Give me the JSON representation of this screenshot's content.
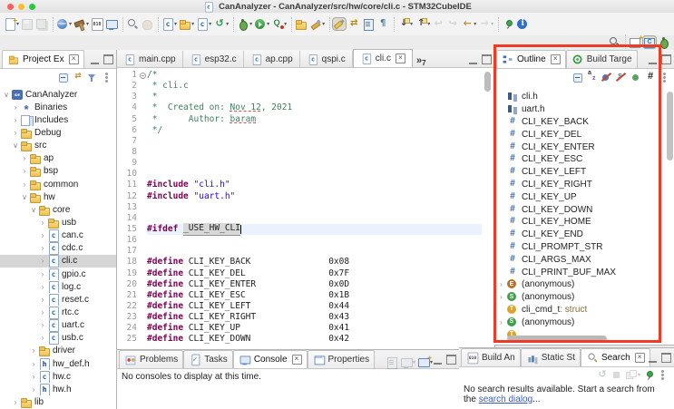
{
  "ui": {
    "dd_glyph": "▾",
    "close_glyph": "×",
    "overflow_glyph": "»"
  },
  "window": {
    "title": "CanAnalyzer - CanAnalyzer/src/hw/core/cli.c - STM32CubeIDE",
    "traffic_red": "#ff5f57",
    "traffic_yellow": "#febc2e",
    "traffic_green": "#28c840"
  },
  "toolbar": {
    "items": [
      {
        "n": "new-wizard-button",
        "cls": "i-newdoc",
        "ddc": "show"
      },
      {
        "n": "save-button",
        "cls": "i-save",
        "state": "dis"
      },
      {
        "n": "save-all-button",
        "cls": "i-saveall",
        "state": "dis"
      },
      {
        "n": "information-center-button",
        "cls": "i-globe",
        "ddc": "show",
        "sepc": "sep"
      },
      {
        "n": "build-button",
        "cls": "i-hammer",
        "ddc": "show"
      },
      {
        "n": "build-binary-button",
        "cls": "i-bin010"
      },
      {
        "n": "terminal-button",
        "cls": "i-term"
      },
      {
        "n": "search-declaration-button",
        "cls": "i-magslash",
        "sepc": "sep"
      },
      {
        "n": "hand-mode-button",
        "cls": "i-hand",
        "state": "dis"
      },
      {
        "n": "new-c-source-button",
        "cls": "i-cfile",
        "ddc": "show",
        "sepc": "sep"
      },
      {
        "n": "new-folder-button",
        "cls": "i-folder",
        "ddc": "show"
      },
      {
        "n": "new-class-button",
        "cls": "i-cfile",
        "ddc": "show"
      },
      {
        "n": "refresh-index-button",
        "cls": "i-refresh",
        "ddc": "show"
      },
      {
        "n": "debug-button",
        "cls": "i-bug",
        "ddc": "show",
        "sepc": "sep"
      },
      {
        "n": "run-button",
        "cls": "i-run",
        "ddc": "show"
      },
      {
        "n": "profile-button",
        "cls": "i-profile",
        "ddc": "show"
      },
      {
        "n": "open-element-button",
        "cls": "i-folder",
        "sepc": "sep"
      },
      {
        "n": "search-button",
        "cls": "i-flash",
        "ddc": "show"
      },
      {
        "n": "mark-occurrences-button",
        "cls": "i-highlight",
        "state": "pr",
        "sepc": "sep"
      },
      {
        "n": "link-with-editor-button",
        "cls": "i-link"
      },
      {
        "n": "show-selected-element-button",
        "cls": "i-bluedoc"
      },
      {
        "n": "show-whitespace-button",
        "cls": "i-pilcrow"
      },
      {
        "n": "next-annotation-button",
        "cls": "i-down",
        "ddc": "show",
        "sepc": "sep"
      },
      {
        "n": "previous-annotation-button",
        "cls": "i-up",
        "ddc": "show"
      },
      {
        "n": "back-history-button",
        "cls": "i-back",
        "state": "dis"
      },
      {
        "n": "forward-history-button",
        "cls": "i-fwd",
        "state": "dis"
      },
      {
        "n": "last-edit-location-button",
        "cls": "i-lastedit",
        "ddc": "show"
      },
      {
        "n": "go-forward-button",
        "cls": "i-fwd2",
        "ddc": "show",
        "state": "dis"
      },
      {
        "n": "pin-editor-button",
        "cls": "i-pin",
        "sepc": "sep"
      },
      {
        "n": "info-button",
        "cls": "i-info"
      }
    ],
    "right_items": [
      {
        "n": "quick-access-search-button",
        "cls": "i-mag"
      },
      {
        "n": "open-perspective-button",
        "cls": "i-perspnew",
        "sepc": "sep"
      },
      {
        "n": "c-cpp-perspective-button",
        "cls": "i-perspc",
        "state": "pr"
      },
      {
        "n": "debug-perspective-button",
        "cls": "i-perspdebug"
      }
    ]
  },
  "explorer": {
    "tab_label": "Project Ex",
    "tools": [
      {
        "n": "collapse-all-button",
        "cls": "i-collapse"
      },
      {
        "n": "link-editor-button",
        "cls": "i-linked"
      },
      {
        "n": "filter-button",
        "cls": "i-filter"
      },
      {
        "n": "view-menu-button",
        "cls": "i-kebab"
      }
    ],
    "items": [
      {
        "chev": "∨",
        "cls": "i-ide",
        "icn": "project-icon",
        "label": "CanAnalyzer",
        "pad": 2
      },
      {
        "chev": "›",
        "cls": "i-binaries",
        "icn": "binaries-icon",
        "label": "Binaries",
        "pad": 12
      },
      {
        "chev": "›",
        "cls": "i-includes",
        "icn": "includes-icon",
        "label": "Includes",
        "pad": 12
      },
      {
        "chev": "›",
        "cls": "i-folder",
        "icn": "folder-icon",
        "label": "Debug",
        "pad": 12
      },
      {
        "chev": "∨",
        "cls": "i-folder",
        "icn": "folder-icon",
        "label": "src",
        "pad": 12
      },
      {
        "chev": "›",
        "cls": "i-folder",
        "icn": "folder-icon",
        "label": "ap",
        "pad": 22
      },
      {
        "chev": "›",
        "cls": "i-folder",
        "icn": "folder-icon",
        "label": "bsp",
        "pad": 22
      },
      {
        "chev": "›",
        "cls": "i-folder",
        "icn": "folder-icon",
        "label": "common",
        "pad": 22
      },
      {
        "chev": "∨",
        "cls": "i-folder",
        "icn": "folder-icon",
        "label": "hw",
        "pad": 22
      },
      {
        "chev": "∨",
        "cls": "i-folder",
        "icn": "folder-icon",
        "label": "core",
        "pad": 32
      },
      {
        "chev": "›",
        "cls": "i-folder",
        "icn": "folder-icon",
        "label": "usb",
        "pad": 42
      },
      {
        "chev": "›",
        "cls": "i-cfile",
        "icn": "c-file-icon",
        "label": "can.c",
        "pad": 42
      },
      {
        "chev": "›",
        "cls": "i-cfile",
        "icn": "c-file-icon",
        "label": "cdc.c",
        "pad": 42
      },
      {
        "chev": "›",
        "cls": "i-cfile",
        "icn": "c-file-icon",
        "label": "cli.c",
        "pad": 42,
        "sel": "sel"
      },
      {
        "chev": "›",
        "cls": "i-cfile",
        "icn": "c-file-icon",
        "label": "gpio.c",
        "pad": 42
      },
      {
        "chev": "›",
        "cls": "i-cfile",
        "icn": "c-file-icon",
        "label": "log.c",
        "pad": 42
      },
      {
        "chev": "›",
        "cls": "i-cfile",
        "icn": "c-file-icon",
        "label": "reset.c",
        "pad": 42
      },
      {
        "chev": "›",
        "cls": "i-cfile",
        "icn": "c-file-icon",
        "label": "rtc.c",
        "pad": 42
      },
      {
        "chev": "›",
        "cls": "i-cfile",
        "icn": "c-file-icon",
        "label": "uart.c",
        "pad": 42
      },
      {
        "chev": "›",
        "cls": "i-cfile",
        "icn": "c-file-icon",
        "label": "usb.c",
        "pad": 42
      },
      {
        "chev": "›",
        "cls": "i-folder",
        "icn": "folder-icon",
        "label": "driver",
        "pad": 32
      },
      {
        "chev": "›",
        "cls": "i-hfile",
        "icn": "h-file-icon",
        "label": "hw_def.h",
        "pad": 32
      },
      {
        "chev": "›",
        "cls": "i-cfile",
        "icn": "c-file-icon",
        "label": "hw.c",
        "pad": 32
      },
      {
        "chev": "›",
        "cls": "i-hfile",
        "icn": "h-file-icon",
        "label": "hw.h",
        "pad": 32
      },
      {
        "chev": "›",
        "cls": "i-folder",
        "icn": "folder-icon",
        "label": "lib",
        "pad": 12
      }
    ]
  },
  "editor": {
    "tabs": [
      {
        "label": "main.cpp",
        "cls": "i-cfile"
      },
      {
        "label": "esp32.c",
        "cls": "i-cfile"
      },
      {
        "label": "ap.cpp",
        "cls": "i-cfile"
      },
      {
        "label": "qspi.c",
        "cls": "i-cfile"
      },
      {
        "label": "cli.c",
        "cls": "i-cfile",
        "act": "active",
        "close": "show"
      }
    ],
    "overflow_count": "7",
    "lines": [
      {
        "n": "1",
        "fold": 1,
        "t": [
          [
            "c",
            "/*"
          ]
        ]
      },
      {
        "n": "2",
        "t": [
          [
            "c",
            " * cli.c"
          ]
        ]
      },
      {
        "n": "3",
        "t": [
          [
            "c",
            " *"
          ]
        ]
      },
      {
        "n": "4",
        "t": [
          [
            "c",
            " *  Created on: "
          ],
          [
            "cu",
            "Nov 12"
          ],
          [
            "c",
            ", 2021"
          ]
        ]
      },
      {
        "n": "5",
        "t": [
          [
            "c",
            " *      Author: "
          ],
          [
            "cu",
            "baram"
          ]
        ]
      },
      {
        "n": "6",
        "t": [
          [
            "c",
            " */"
          ]
        ]
      },
      {
        "n": "7",
        "t": []
      },
      {
        "n": "8",
        "t": []
      },
      {
        "n": "9",
        "t": []
      },
      {
        "n": "10",
        "t": []
      },
      {
        "n": "11",
        "t": [
          [
            "k",
            "#include"
          ],
          [
            "p",
            " "
          ],
          [
            "s",
            "\"cli.h\""
          ]
        ]
      },
      {
        "n": "12",
        "t": [
          [
            "k",
            "#include"
          ],
          [
            "p",
            " "
          ],
          [
            "s",
            "\"uart.h\""
          ]
        ]
      },
      {
        "n": "13",
        "t": []
      },
      {
        "n": "14",
        "t": []
      },
      {
        "n": "15",
        "cur": 1,
        "caret": 1,
        "t": [
          [
            "k",
            "#ifdef"
          ],
          [
            "p",
            " "
          ],
          [
            "occ",
            "_USE_HW_CLI"
          ]
        ]
      },
      {
        "n": "16",
        "t": []
      },
      {
        "n": "17",
        "t": []
      },
      {
        "n": "18",
        "t": [
          [
            "k",
            "#define"
          ],
          [
            "p",
            " CLI_KEY_BACK               0x08"
          ]
        ]
      },
      {
        "n": "19",
        "t": [
          [
            "k",
            "#define"
          ],
          [
            "p",
            " CLI_KEY_DEL                0x7F"
          ]
        ]
      },
      {
        "n": "20",
        "t": [
          [
            "k",
            "#define"
          ],
          [
            "p",
            " CLI_KEY_ENTER              0x0D"
          ]
        ]
      },
      {
        "n": "21",
        "t": [
          [
            "k",
            "#define"
          ],
          [
            "p",
            " CLI_KEY_ESC                0x1B"
          ]
        ]
      },
      {
        "n": "22",
        "t": [
          [
            "k",
            "#define"
          ],
          [
            "p",
            " CLI_KEY_LEFT               0x44"
          ]
        ]
      },
      {
        "n": "23",
        "t": [
          [
            "k",
            "#define"
          ],
          [
            "p",
            " CLI_KEY_RIGHT              0x43"
          ]
        ]
      },
      {
        "n": "24",
        "t": [
          [
            "k",
            "#define"
          ],
          [
            "p",
            " CLI_KEY_UP                 0x41"
          ]
        ]
      },
      {
        "n": "25",
        "t": [
          [
            "k",
            "#define"
          ],
          [
            "p",
            " CLI_KEY_DOWN               0x42"
          ]
        ]
      }
    ]
  },
  "outline": {
    "tabs": [
      {
        "label": "Outline",
        "cls": "i-outline",
        "act": "active",
        "close": "show",
        "icn": "outline-icon"
      },
      {
        "label": "Build Targe",
        "cls": "i-target",
        "icn": "build-targets-icon"
      }
    ],
    "tools": [
      {
        "n": "collapse-all-button",
        "cls": "i-collapse"
      },
      {
        "n": "sort-button",
        "cls": "i-sortaz"
      },
      {
        "n": "hide-fields-button",
        "cls": "i-hidefield"
      },
      {
        "n": "hide-static-members-button",
        "cls": "i-hidestatic"
      },
      {
        "n": "hide-non-public-button",
        "cls": "i-greendot"
      },
      {
        "n": "hide-macro-directives-button",
        "cls": "i-hash"
      },
      {
        "n": "view-menu-button",
        "cls": "i-kebab"
      }
    ],
    "items": [
      {
        "cls": "i-incsym",
        "icn": "include-icon",
        "label": "cli.h"
      },
      {
        "cls": "i-incsym",
        "icn": "include-icon",
        "label": "uart.h"
      },
      {
        "cls": "i-def",
        "icn": "define-icon",
        "label": "CLI_KEY_BACK"
      },
      {
        "cls": "i-def",
        "icn": "define-icon",
        "label": "CLI_KEY_DEL"
      },
      {
        "cls": "i-def",
        "icn": "define-icon",
        "label": "CLI_KEY_ENTER"
      },
      {
        "cls": "i-def",
        "icn": "define-icon",
        "label": "CLI_KEY_ESC"
      },
      {
        "cls": "i-def",
        "icn": "define-icon",
        "label": "CLI_KEY_LEFT"
      },
      {
        "cls": "i-def",
        "icn": "define-icon",
        "label": "CLI_KEY_RIGHT"
      },
      {
        "cls": "i-def",
        "icn": "define-icon",
        "label": "CLI_KEY_UP"
      },
      {
        "cls": "i-def",
        "icn": "define-icon",
        "label": "CLI_KEY_DOWN"
      },
      {
        "cls": "i-def",
        "icn": "define-icon",
        "label": "CLI_KEY_HOME"
      },
      {
        "cls": "i-def",
        "icn": "define-icon",
        "label": "CLI_KEY_END"
      },
      {
        "cls": "i-def",
        "icn": "define-icon",
        "label": "CLI_PROMPT_STR"
      },
      {
        "cls": "i-def",
        "icn": "define-icon",
        "label": "CLI_ARGS_MAX"
      },
      {
        "cls": "i-def",
        "icn": "define-icon",
        "label": "CLI_PRINT_BUF_MAX"
      },
      {
        "chev": "›",
        "cls": "i-enum",
        "icn": "enum-icon",
        "label": "(anonymous)"
      },
      {
        "chev": "›",
        "cls": "i-struct",
        "icn": "struct-icon",
        "label": "(anonymous)"
      },
      {
        "cls": "i-typedef",
        "icn": "typedef-icon",
        "label": "cli_cmd_t",
        "suffix": " : struct"
      },
      {
        "chev": "›",
        "cls": "i-struct",
        "icn": "struct-icon",
        "label": "(anonymous)"
      },
      {
        "cls": "i-typedef",
        "icn": "typedef-icon",
        "label": ""
      }
    ]
  },
  "console_panel": {
    "tabs": [
      {
        "label": "Problems",
        "cls": "i-problems",
        "icn": "problems-icon"
      },
      {
        "label": "Tasks",
        "cls": "i-tasks",
        "icn": "tasks-icon"
      },
      {
        "label": "Console",
        "cls": "i-console",
        "act": "active",
        "close": "show",
        "icn": "console-icon"
      },
      {
        "label": "Properties",
        "cls": "i-props",
        "icn": "properties-icon"
      }
    ],
    "tools": [
      {
        "n": "pin-console-button",
        "cls": "i-bluedoc",
        "state": "dis"
      },
      {
        "n": "display-selected-console-button",
        "cls": "i-console",
        "state": "dis",
        "ddc": "show"
      },
      {
        "n": "open-console-button",
        "cls": "i-consolenew",
        "ddc": "show"
      }
    ],
    "message": "No consoles to display at this time."
  },
  "search_panel": {
    "tabs": [
      {
        "label": "Build An",
        "cls": "i-bin010",
        "icn": "build-analyzer-icon"
      },
      {
        "label": "Static St",
        "cls": "i-chart",
        "icn": "static-stack-icon"
      },
      {
        "label": "Search",
        "cls": "i-searchtab",
        "act": "active",
        "close": "show",
        "icn": "search-icon"
      }
    ],
    "tools": [
      {
        "n": "run-search-again-button",
        "cls": "i-refresh",
        "state": "dis"
      },
      {
        "n": "cancel-search-button",
        "cls": "i-stop",
        "state": "dis"
      },
      {
        "n": "previous-searches-button",
        "cls": "i-layers",
        "ddc": "show",
        "state": "dis"
      },
      {
        "n": "pin-search-view-button",
        "cls": "i-pin"
      },
      {
        "n": "view-menu-button",
        "cls": "i-kebab"
      }
    ],
    "msg_before": "No search results available. Start a search from the ",
    "link_label": "search dialog",
    "msg_after": "..."
  }
}
